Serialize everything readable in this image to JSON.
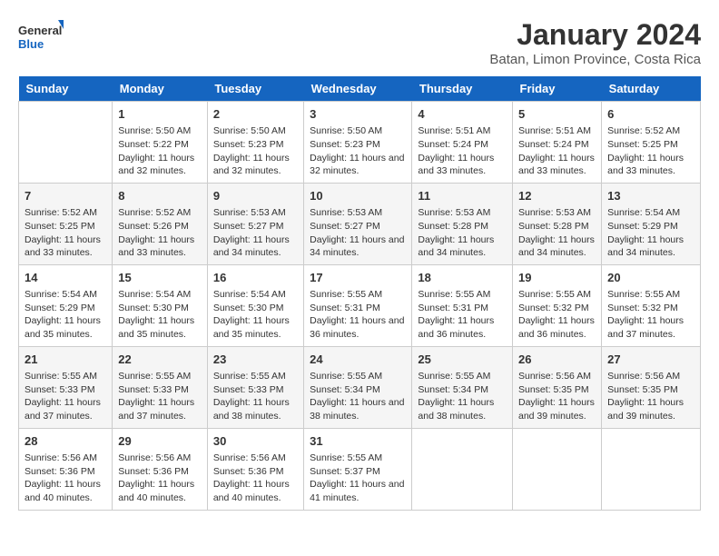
{
  "header": {
    "logo": {
      "general": "General",
      "blue": "Blue"
    },
    "title": "January 2024",
    "subtitle": "Batan, Limon Province, Costa Rica"
  },
  "weekdays": [
    "Sunday",
    "Monday",
    "Tuesday",
    "Wednesday",
    "Thursday",
    "Friday",
    "Saturday"
  ],
  "weeks": [
    [
      {
        "day": "",
        "sunrise": "",
        "sunset": "",
        "daylight": ""
      },
      {
        "day": "1",
        "sunrise": "Sunrise: 5:50 AM",
        "sunset": "Sunset: 5:22 PM",
        "daylight": "Daylight: 11 hours and 32 minutes."
      },
      {
        "day": "2",
        "sunrise": "Sunrise: 5:50 AM",
        "sunset": "Sunset: 5:23 PM",
        "daylight": "Daylight: 11 hours and 32 minutes."
      },
      {
        "day": "3",
        "sunrise": "Sunrise: 5:50 AM",
        "sunset": "Sunset: 5:23 PM",
        "daylight": "Daylight: 11 hours and 32 minutes."
      },
      {
        "day": "4",
        "sunrise": "Sunrise: 5:51 AM",
        "sunset": "Sunset: 5:24 PM",
        "daylight": "Daylight: 11 hours and 33 minutes."
      },
      {
        "day": "5",
        "sunrise": "Sunrise: 5:51 AM",
        "sunset": "Sunset: 5:24 PM",
        "daylight": "Daylight: 11 hours and 33 minutes."
      },
      {
        "day": "6",
        "sunrise": "Sunrise: 5:52 AM",
        "sunset": "Sunset: 5:25 PM",
        "daylight": "Daylight: 11 hours and 33 minutes."
      }
    ],
    [
      {
        "day": "7",
        "sunrise": "Sunrise: 5:52 AM",
        "sunset": "Sunset: 5:25 PM",
        "daylight": "Daylight: 11 hours and 33 minutes."
      },
      {
        "day": "8",
        "sunrise": "Sunrise: 5:52 AM",
        "sunset": "Sunset: 5:26 PM",
        "daylight": "Daylight: 11 hours and 33 minutes."
      },
      {
        "day": "9",
        "sunrise": "Sunrise: 5:53 AM",
        "sunset": "Sunset: 5:27 PM",
        "daylight": "Daylight: 11 hours and 34 minutes."
      },
      {
        "day": "10",
        "sunrise": "Sunrise: 5:53 AM",
        "sunset": "Sunset: 5:27 PM",
        "daylight": "Daylight: 11 hours and 34 minutes."
      },
      {
        "day": "11",
        "sunrise": "Sunrise: 5:53 AM",
        "sunset": "Sunset: 5:28 PM",
        "daylight": "Daylight: 11 hours and 34 minutes."
      },
      {
        "day": "12",
        "sunrise": "Sunrise: 5:53 AM",
        "sunset": "Sunset: 5:28 PM",
        "daylight": "Daylight: 11 hours and 34 minutes."
      },
      {
        "day": "13",
        "sunrise": "Sunrise: 5:54 AM",
        "sunset": "Sunset: 5:29 PM",
        "daylight": "Daylight: 11 hours and 34 minutes."
      }
    ],
    [
      {
        "day": "14",
        "sunrise": "Sunrise: 5:54 AM",
        "sunset": "Sunset: 5:29 PM",
        "daylight": "Daylight: 11 hours and 35 minutes."
      },
      {
        "day": "15",
        "sunrise": "Sunrise: 5:54 AM",
        "sunset": "Sunset: 5:30 PM",
        "daylight": "Daylight: 11 hours and 35 minutes."
      },
      {
        "day": "16",
        "sunrise": "Sunrise: 5:54 AM",
        "sunset": "Sunset: 5:30 PM",
        "daylight": "Daylight: 11 hours and 35 minutes."
      },
      {
        "day": "17",
        "sunrise": "Sunrise: 5:55 AM",
        "sunset": "Sunset: 5:31 PM",
        "daylight": "Daylight: 11 hours and 36 minutes."
      },
      {
        "day": "18",
        "sunrise": "Sunrise: 5:55 AM",
        "sunset": "Sunset: 5:31 PM",
        "daylight": "Daylight: 11 hours and 36 minutes."
      },
      {
        "day": "19",
        "sunrise": "Sunrise: 5:55 AM",
        "sunset": "Sunset: 5:32 PM",
        "daylight": "Daylight: 11 hours and 36 minutes."
      },
      {
        "day": "20",
        "sunrise": "Sunrise: 5:55 AM",
        "sunset": "Sunset: 5:32 PM",
        "daylight": "Daylight: 11 hours and 37 minutes."
      }
    ],
    [
      {
        "day": "21",
        "sunrise": "Sunrise: 5:55 AM",
        "sunset": "Sunset: 5:33 PM",
        "daylight": "Daylight: 11 hours and 37 minutes."
      },
      {
        "day": "22",
        "sunrise": "Sunrise: 5:55 AM",
        "sunset": "Sunset: 5:33 PM",
        "daylight": "Daylight: 11 hours and 37 minutes."
      },
      {
        "day": "23",
        "sunrise": "Sunrise: 5:55 AM",
        "sunset": "Sunset: 5:33 PM",
        "daylight": "Daylight: 11 hours and 38 minutes."
      },
      {
        "day": "24",
        "sunrise": "Sunrise: 5:55 AM",
        "sunset": "Sunset: 5:34 PM",
        "daylight": "Daylight: 11 hours and 38 minutes."
      },
      {
        "day": "25",
        "sunrise": "Sunrise: 5:55 AM",
        "sunset": "Sunset: 5:34 PM",
        "daylight": "Daylight: 11 hours and 38 minutes."
      },
      {
        "day": "26",
        "sunrise": "Sunrise: 5:56 AM",
        "sunset": "Sunset: 5:35 PM",
        "daylight": "Daylight: 11 hours and 39 minutes."
      },
      {
        "day": "27",
        "sunrise": "Sunrise: 5:56 AM",
        "sunset": "Sunset: 5:35 PM",
        "daylight": "Daylight: 11 hours and 39 minutes."
      }
    ],
    [
      {
        "day": "28",
        "sunrise": "Sunrise: 5:56 AM",
        "sunset": "Sunset: 5:36 PM",
        "daylight": "Daylight: 11 hours and 40 minutes."
      },
      {
        "day": "29",
        "sunrise": "Sunrise: 5:56 AM",
        "sunset": "Sunset: 5:36 PM",
        "daylight": "Daylight: 11 hours and 40 minutes."
      },
      {
        "day": "30",
        "sunrise": "Sunrise: 5:56 AM",
        "sunset": "Sunset: 5:36 PM",
        "daylight": "Daylight: 11 hours and 40 minutes."
      },
      {
        "day": "31",
        "sunrise": "Sunrise: 5:55 AM",
        "sunset": "Sunset: 5:37 PM",
        "daylight": "Daylight: 11 hours and 41 minutes."
      },
      {
        "day": "",
        "sunrise": "",
        "sunset": "",
        "daylight": ""
      },
      {
        "day": "",
        "sunrise": "",
        "sunset": "",
        "daylight": ""
      },
      {
        "day": "",
        "sunrise": "",
        "sunset": "",
        "daylight": ""
      }
    ]
  ]
}
